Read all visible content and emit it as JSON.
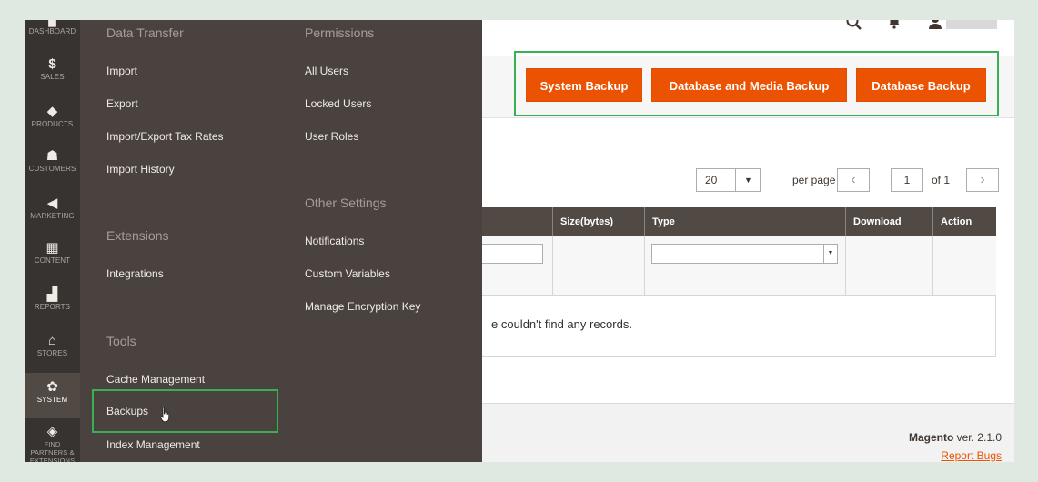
{
  "sidebar": {
    "items": [
      {
        "label": "DASHBOARD",
        "icon": "dashboard-icon",
        "glyph": "▅"
      },
      {
        "label": "SALES",
        "icon": "dollar-icon",
        "glyph": "$"
      },
      {
        "label": "PRODUCTS",
        "icon": "cube-icon",
        "glyph": "◆"
      },
      {
        "label": "CUSTOMERS",
        "icon": "person-icon",
        "glyph": "☗"
      },
      {
        "label": "MARKETING",
        "icon": "megaphone-icon",
        "glyph": "◀"
      },
      {
        "label": "CONTENT",
        "icon": "layout-icon",
        "glyph": "▦"
      },
      {
        "label": "REPORTS",
        "icon": "bar-chart-icon",
        "glyph": "▟"
      },
      {
        "label": "STORES",
        "icon": "storefront-icon",
        "glyph": "⌂"
      },
      {
        "label": "SYSTEM",
        "icon": "gear-icon",
        "glyph": "✿"
      },
      {
        "label": "FIND PARTNERS & EXTENSIONS",
        "icon": "box-icon",
        "glyph": "◈"
      }
    ]
  },
  "menu": {
    "data_transfer": {
      "title": "Data Transfer",
      "items": [
        "Import",
        "Export",
        "Import/Export Tax Rates",
        "Import History"
      ]
    },
    "extensions": {
      "title": "Extensions",
      "items": [
        "Integrations"
      ]
    },
    "tools": {
      "title": "Tools",
      "items": [
        "Cache Management",
        "Backups",
        "Index Management"
      ]
    },
    "permissions": {
      "title": "Permissions",
      "items": [
        "All Users",
        "Locked Users",
        "User Roles"
      ]
    },
    "other_settings": {
      "title": "Other Settings",
      "items": [
        "Notifications",
        "Custom Variables",
        "Manage Encryption Key"
      ]
    }
  },
  "header": {
    "search_icon": "search-icon",
    "bell_icon": "bell-icon",
    "user_icon": "user-icon"
  },
  "actions": {
    "system_backup": "System Backup",
    "db_media_backup": "Database and Media Backup",
    "db_backup": "Database Backup"
  },
  "pager": {
    "per_page_value": "20",
    "per_page_label": "per page",
    "page_value": "1",
    "page_total": "of 1",
    "prev_glyph": "‹",
    "next_glyph": "›"
  },
  "grid": {
    "columns": [
      "Size(bytes)",
      "Type",
      "Download",
      "Action"
    ],
    "empty_message": "e couldn't find any records."
  },
  "footer": {
    "brand": "Magento",
    "version": " ver. 2.1.0",
    "report_bugs": "Report Bugs"
  },
  "colors": {
    "accent": "#eb5202",
    "highlight": "#3aae52",
    "sidebar": "#373330",
    "flyout": "#4a423e"
  }
}
